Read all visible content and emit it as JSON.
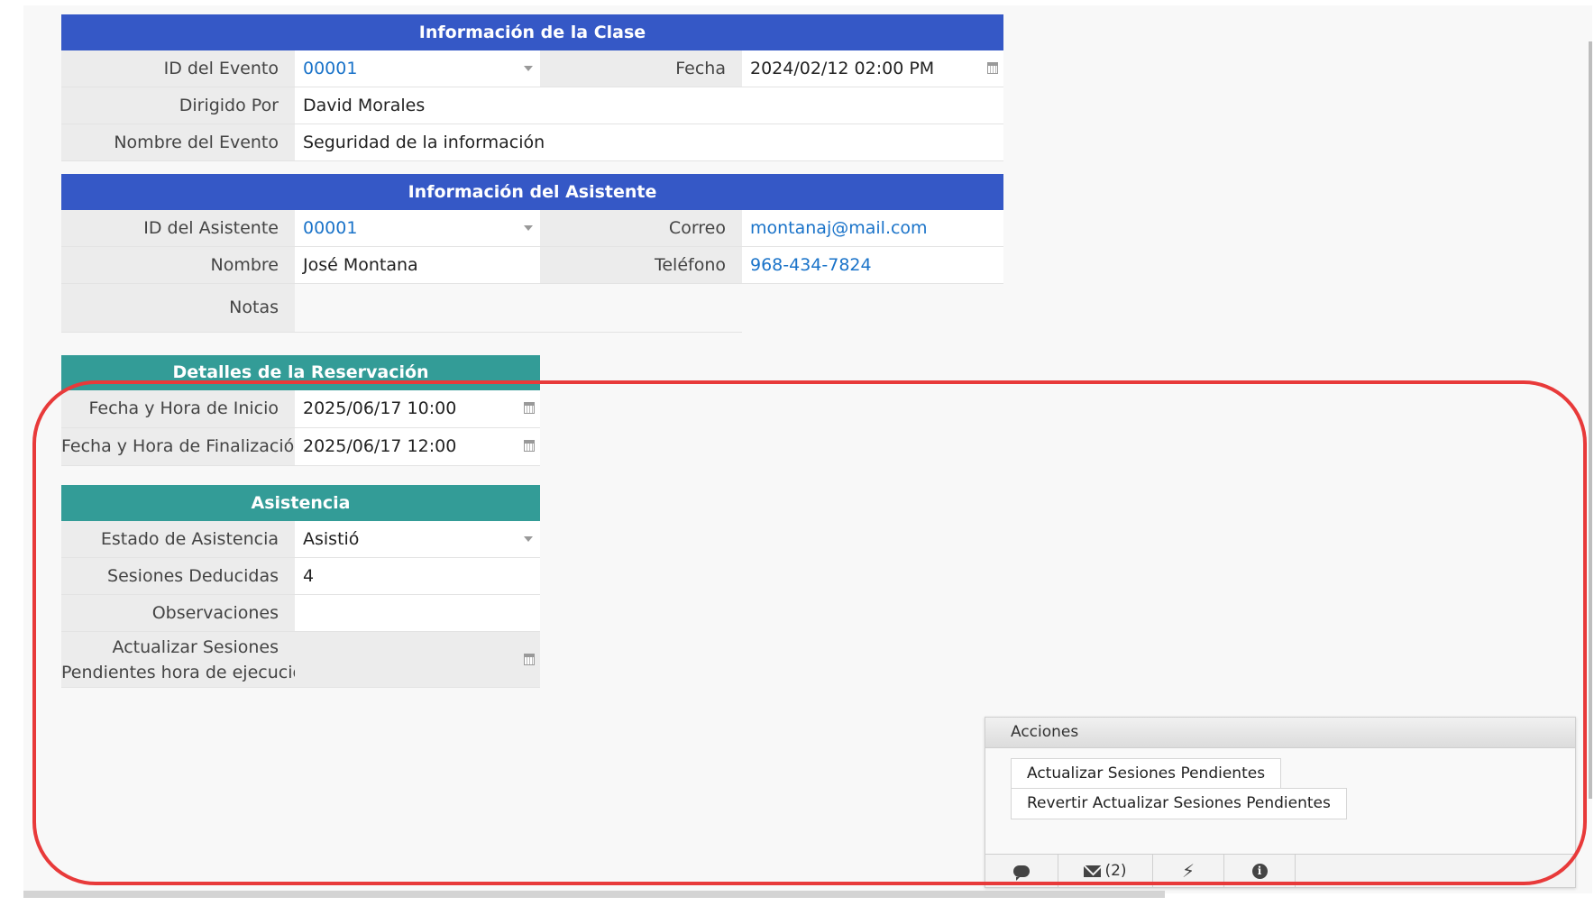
{
  "clase": {
    "title": "Información de la Clase",
    "id_evento_label": "ID del Evento",
    "id_evento_value": "00001",
    "fecha_label": "Fecha",
    "fecha_value": "2024/02/12 02:00 PM",
    "dirigido_label": "Dirigido Por",
    "dirigido_value": "David Morales",
    "nombre_evento_label": "Nombre del Evento",
    "nombre_evento_value": "Seguridad de la información"
  },
  "asistente": {
    "title": "Información del Asistente",
    "id_label": "ID del Asistente",
    "id_value": "00001",
    "correo_label": "Correo",
    "correo_value": "montanaj@mail.com",
    "nombre_label": "Nombre",
    "nombre_value": "José Montana",
    "telefono_label": "Teléfono",
    "telefono_value": "968-434-7824",
    "notas_label": "Notas",
    "notas_value": ""
  },
  "reservacion": {
    "title": "Detalles de la Reservación",
    "inicio_label": "Fecha y Hora de Inicio",
    "inicio_value": "2025/06/17 10:00",
    "fin_label": "Fecha y Hora de Finalización",
    "fin_value": "2025/06/17 12:00"
  },
  "asistencia": {
    "title": "Asistencia",
    "estado_label": "Estado de Asistencia",
    "estado_value": "Asistió",
    "sesiones_label": "Sesiones Deducidas",
    "sesiones_value": "4",
    "observaciones_label": "Observaciones",
    "observaciones_value": "",
    "actualizar_label_line1": "Actualizar Sesiones",
    "actualizar_label_line2": "Pendientes hora de ejecución",
    "actualizar_value": ""
  },
  "acciones": {
    "title": "Acciones",
    "btn_actualizar": "Actualizar Sesiones Pendientes",
    "btn_revertir": "Revertir Actualizar Sesiones Pendientes",
    "footer": {
      "comment_icon": "comment-icon",
      "mail_icon": "envelope-icon",
      "mail_count": "(2)",
      "bolt_icon": "bolt-icon",
      "info_icon": "info-icon"
    }
  },
  "colors": {
    "section_blue": "#3558c6",
    "section_teal": "#339c97",
    "link": "#1a73c9",
    "annotation_red": "#e83a3a"
  }
}
